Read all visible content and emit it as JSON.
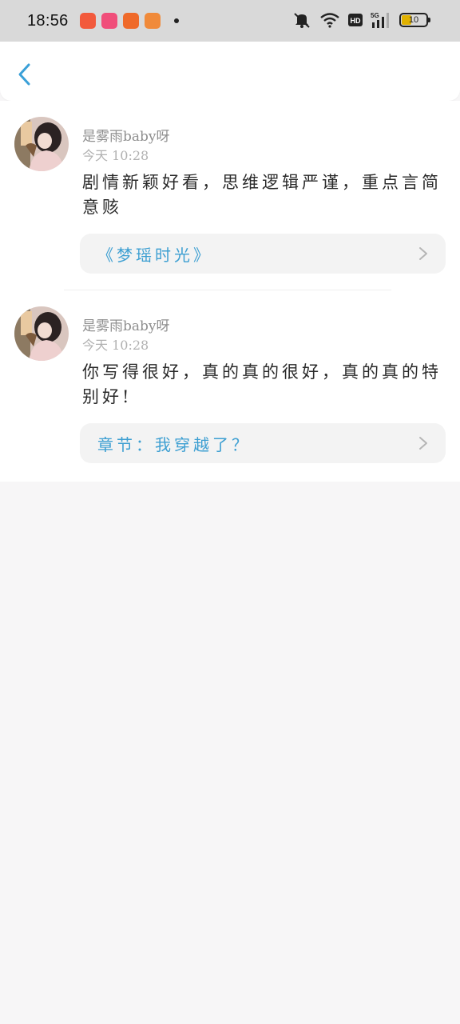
{
  "status_bar": {
    "time": "18:56",
    "battery": "10",
    "app_icon_colors": [
      "#f25a3c",
      "#f04e7a",
      "#ef6a2a",
      "#f08a3a"
    ],
    "icons": [
      "silent-icon",
      "wifi-icon",
      "hd-icon",
      "5g-signal-icon",
      "battery-icon"
    ]
  },
  "nav": {
    "back_icon": "chevron-left-icon",
    "accent": "#3aa0d8"
  },
  "comments": [
    {
      "user": "是雾雨baby呀",
      "time": "今天 10:28",
      "content": "剧情新颖好看，思维逻辑严谨，重点言简意赅",
      "source": "《梦瑶时光》"
    },
    {
      "user": "是雾雨baby呀",
      "time": "今天 10:28",
      "content": "你写得很好，真的真的很好，真的真的特别好!",
      "source": "章节：我穿越了？"
    }
  ],
  "colors": {
    "link": "#3d9fd2",
    "name": "#8f8f8f",
    "time": "#b1b1b1",
    "background": "#f7f6f7"
  }
}
